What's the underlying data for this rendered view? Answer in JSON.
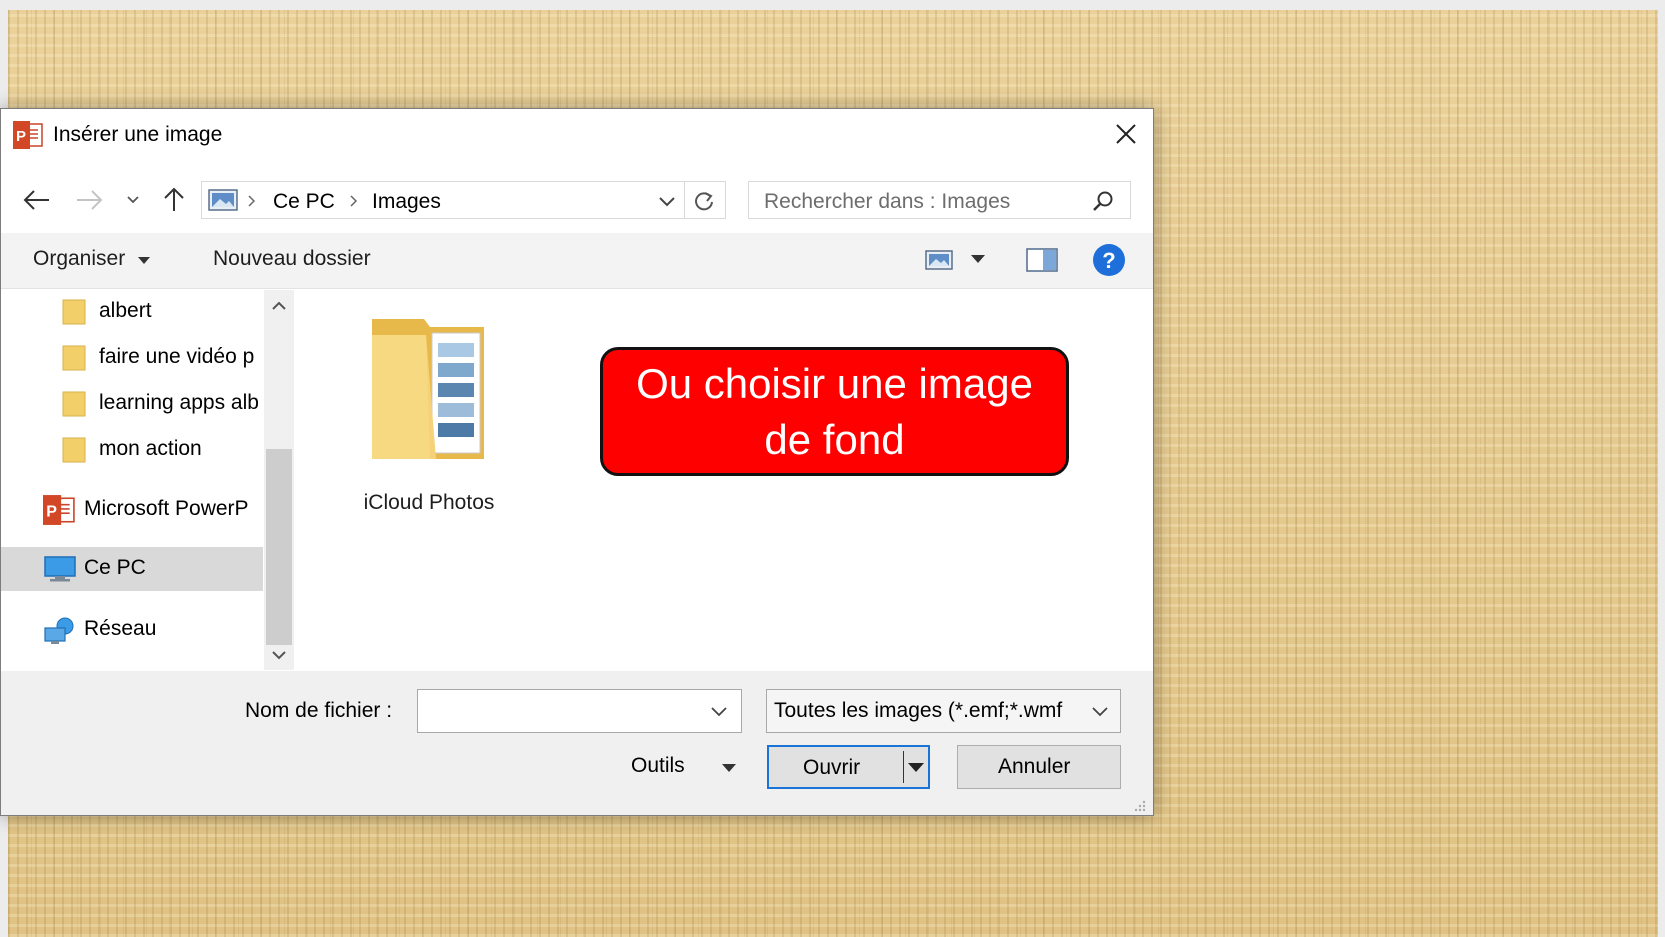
{
  "dialog": {
    "title": "Insérer une image",
    "breadcrumb": [
      "Ce PC",
      "Images"
    ],
    "search_placeholder": "Rechercher dans : Images"
  },
  "toolbar": {
    "organize_label": "Organiser",
    "new_folder_label": "Nouveau dossier"
  },
  "sidebar": {
    "items": [
      {
        "label": "albert",
        "icon": "folder-icon"
      },
      {
        "label": "faire une vidéo p",
        "icon": "folder-icon"
      },
      {
        "label": "learning apps alb",
        "icon": "folder-icon"
      },
      {
        "label": "mon action",
        "icon": "folder-icon"
      },
      {
        "label": "Microsoft PowerP",
        "icon": "powerpoint-icon"
      },
      {
        "label": "Ce PC",
        "icon": "computer-icon",
        "selected": true
      },
      {
        "label": "Réseau",
        "icon": "network-icon"
      }
    ]
  },
  "content": {
    "items": [
      {
        "label": "iCloud Photos",
        "icon": "folder-icon"
      }
    ]
  },
  "bottom": {
    "filename_label": "Nom de fichier :",
    "filename_value": "",
    "filetype_value": "Toutes les images (*.emf;*.wmf",
    "tools_label": "Outils",
    "open_label": "Ouvrir",
    "cancel_label": "Annuler"
  },
  "callout": {
    "line1": "Ou choisir une image",
    "line2": "de fond"
  },
  "colors": {
    "callout_bg": "#ff0000",
    "accent": "#1a73d6",
    "help": "#1e6fd9",
    "folder": "#f3cf6a"
  }
}
